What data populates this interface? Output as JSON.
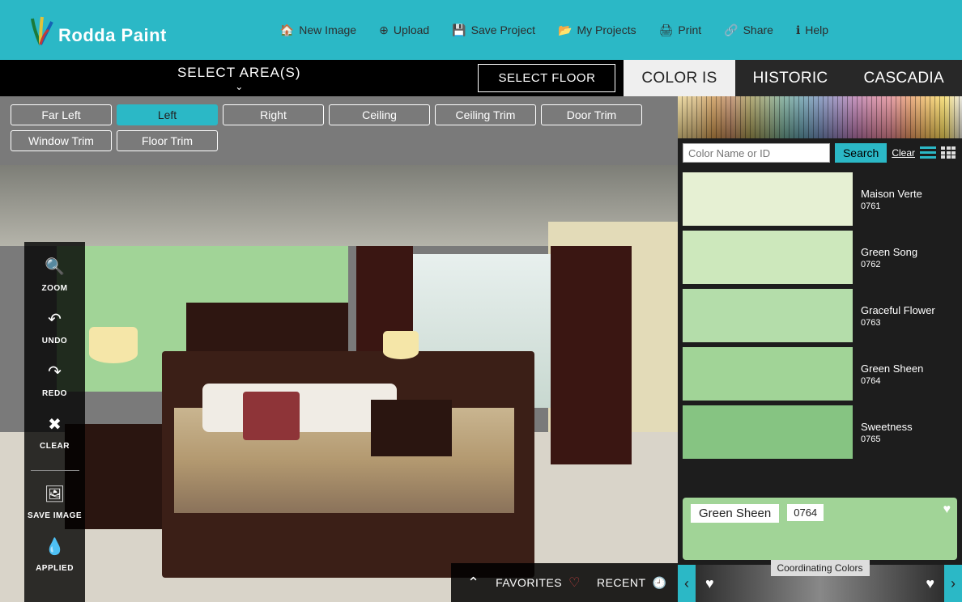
{
  "brand": "Rodda Paint",
  "menu": [
    {
      "icon": "🏠",
      "label": "New Image"
    },
    {
      "icon": "⊕",
      "label": "Upload"
    },
    {
      "icon": "💾",
      "label": "Save Project"
    },
    {
      "icon": "📂",
      "label": "My Projects"
    },
    {
      "icon": "🖨",
      "label": "Print"
    },
    {
      "icon": "🔗",
      "label": "Share"
    },
    {
      "icon": "ℹ",
      "label": "Help"
    }
  ],
  "select_area_title": "SELECT AREA(S)",
  "select_floor": "SELECT FLOOR",
  "tabs": [
    "COLOR IS",
    "HISTORIC",
    "CASCADIA"
  ],
  "active_tab": 0,
  "areas": [
    "Far Left",
    "Left",
    "Right",
    "Ceiling",
    "Ceiling Trim",
    "Door Trim",
    "Window Trim",
    "Floor Trim"
  ],
  "selected_area": "Left",
  "tools": [
    {
      "icon": "🔍",
      "label": "ZOOM"
    },
    {
      "icon": "↶",
      "label": "UNDO"
    },
    {
      "icon": "↷",
      "label": "REDO"
    },
    {
      "icon": "✖",
      "label": "CLEAR"
    }
  ],
  "tools2": [
    {
      "icon": "🖼",
      "label": "SAVE IMAGE"
    },
    {
      "icon": "💧",
      "label": "APPLIED"
    }
  ],
  "favorites_label": "FAVORITES",
  "recent_label": "RECENT",
  "search": {
    "placeholder": "Color Name or ID",
    "button": "Search",
    "clear": "Clear"
  },
  "colors": [
    {
      "name": "Maison Verte",
      "id": "0761",
      "hex": "#e6f0d3"
    },
    {
      "name": "Green Song",
      "id": "0762",
      "hex": "#cde8bc"
    },
    {
      "name": "Graceful Flower",
      "id": "0763",
      "hex": "#b4ddaa"
    },
    {
      "name": "Green Sheen",
      "id": "0764",
      "hex": "#a1d497"
    },
    {
      "name": "Sweetness",
      "id": "0765",
      "hex": "#86c482"
    }
  ],
  "selected_color": {
    "name": "Green Sheen",
    "id": "0764",
    "hex": "#a1d497"
  },
  "coord_label": "Coordinating Colors"
}
